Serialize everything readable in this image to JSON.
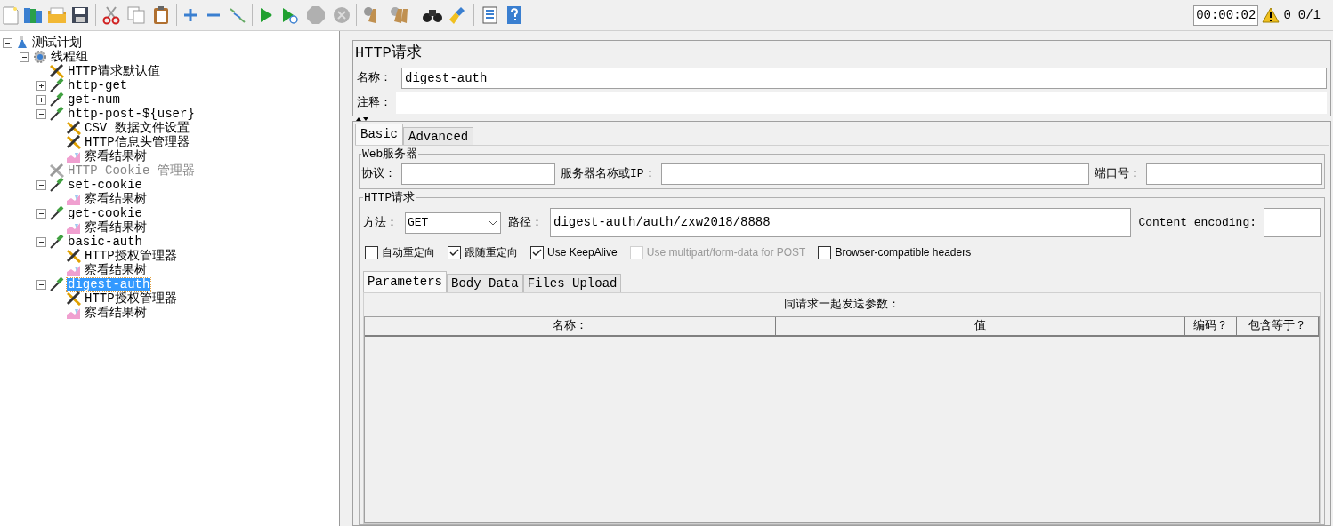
{
  "status": {
    "timer": "00:00:02",
    "warnings": "0",
    "threads": "0/1"
  },
  "tree": [
    {
      "label": "测试计划",
      "kind": "plan",
      "expanded": true,
      "selected": false,
      "disabled": false,
      "children": [
        {
          "label": "线程组",
          "kind": "threadgroup",
          "expanded": true,
          "selected": false,
          "disabled": false,
          "children": [
            {
              "label": "HTTP请求默认值",
              "kind": "config",
              "selected": false,
              "disabled": false
            },
            {
              "label": "http-get",
              "kind": "sampler",
              "expanded": false,
              "selected": false,
              "disabled": false
            },
            {
              "label": "get-num",
              "kind": "sampler",
              "expanded": false,
              "selected": false,
              "disabled": false
            },
            {
              "label": "http-post-${user}",
              "kind": "sampler",
              "expanded": true,
              "selected": false,
              "disabled": false,
              "children": [
                {
                  "label": "CSV 数据文件设置",
                  "kind": "config",
                  "selected": false,
                  "disabled": false
                },
                {
                  "label": "HTTP信息头管理器",
                  "kind": "config",
                  "selected": false,
                  "disabled": false
                },
                {
                  "label": "察看结果树",
                  "kind": "listener",
                  "selected": false,
                  "disabled": false
                }
              ]
            },
            {
              "label": "HTTP Cookie 管理器",
              "kind": "config",
              "selected": false,
              "disabled": true
            },
            {
              "label": "set-cookie",
              "kind": "sampler",
              "expanded": true,
              "selected": false,
              "disabled": false,
              "children": [
                {
                  "label": "察看结果树",
                  "kind": "listener",
                  "selected": false,
                  "disabled": false
                }
              ]
            },
            {
              "label": "get-cookie",
              "kind": "sampler",
              "expanded": true,
              "selected": false,
              "disabled": false,
              "children": [
                {
                  "label": "察看结果树",
                  "kind": "listener",
                  "selected": false,
                  "disabled": false
                }
              ]
            },
            {
              "label": "basic-auth",
              "kind": "sampler",
              "expanded": true,
              "selected": false,
              "disabled": false,
              "children": [
                {
                  "label": "HTTP授权管理器",
                  "kind": "config",
                  "selected": false,
                  "disabled": false
                },
                {
                  "label": "察看结果树",
                  "kind": "listener",
                  "selected": false,
                  "disabled": false
                }
              ]
            },
            {
              "label": "digest-auth",
              "kind": "sampler",
              "expanded": true,
              "selected": true,
              "disabled": false,
              "children": [
                {
                  "label": "HTTP授权管理器",
                  "kind": "config",
                  "selected": false,
                  "disabled": false
                },
                {
                  "label": "察看结果树",
                  "kind": "listener",
                  "selected": false,
                  "disabled": false
                }
              ]
            }
          ]
        }
      ]
    }
  ],
  "panel": {
    "title": "HTTP请求",
    "name_label": "名称：",
    "name_value": "digest-auth",
    "comment_label": "注释：",
    "tabs": [
      {
        "label": "Basic",
        "selected": true
      },
      {
        "label": "Advanced",
        "selected": false
      }
    ],
    "web_server": {
      "legend": "Web服务器",
      "protocol_label": "协议：",
      "server_label": "服务器名称或IP：",
      "port_label": "端口号："
    },
    "http_request": {
      "legend": "HTTP请求",
      "method_label": "方法：",
      "method": "GET",
      "path_label": "路径：",
      "path": "digest-auth/auth/zxw2018/8888",
      "encoding_label": "Content encoding:",
      "options": [
        {
          "label": "自动重定向",
          "checked": false,
          "disabled": false
        },
        {
          "label": "跟随重定向",
          "checked": true,
          "disabled": false
        },
        {
          "label": "Use KeepAlive",
          "checked": true,
          "disabled": false
        },
        {
          "label": "Use multipart/form-data for POST",
          "checked": false,
          "disabled": true
        },
        {
          "label": "Browser-compatible headers",
          "checked": false,
          "disabled": false
        }
      ]
    },
    "sub_tabs": [
      {
        "label": "Parameters",
        "selected": true
      },
      {
        "label": "Body Data",
        "selected": false
      },
      {
        "label": "Files Upload",
        "selected": false
      }
    ],
    "params_caption": "同请求一起发送参数：",
    "table": {
      "columns": [
        "名称：",
        "值",
        "编码？",
        "包含等于？"
      ]
    }
  }
}
